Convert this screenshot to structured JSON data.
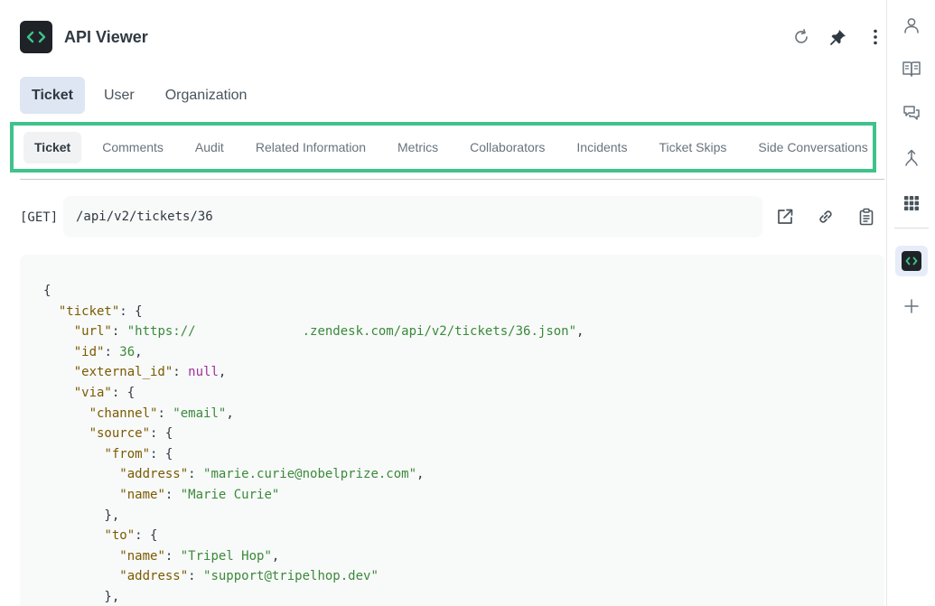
{
  "header": {
    "title": "API Viewer",
    "icons": [
      "refresh-icon",
      "pin-icon",
      "more-vertical-icon"
    ]
  },
  "primary_tabs": [
    {
      "label": "Ticket",
      "active": true
    },
    {
      "label": "User",
      "active": false
    },
    {
      "label": "Organization",
      "active": false
    }
  ],
  "sub_tabs": [
    {
      "label": "Ticket",
      "active": true
    },
    {
      "label": "Comments",
      "active": false
    },
    {
      "label": "Audit",
      "active": false
    },
    {
      "label": "Related Information",
      "active": false
    },
    {
      "label": "Metrics",
      "active": false
    },
    {
      "label": "Collaborators",
      "active": false
    },
    {
      "label": "Incidents",
      "active": false
    },
    {
      "label": "Ticket Skips",
      "active": false
    },
    {
      "label": "Side Conversations",
      "active": false
    }
  ],
  "request": {
    "method": "[GET]",
    "path": "/api/v2/tickets/36",
    "actions": [
      "open-external-icon",
      "link-icon",
      "copy-clipboard-icon"
    ]
  },
  "json_view": {
    "lines": [
      "{",
      "  \"ticket\": {",
      "    \"url\": \"https://              .zendesk.com/api/v2/tickets/36.json\",",
      "    \"id\": 36,",
      "    \"external_id\": null,",
      "    \"via\": {",
      "      \"channel\": \"email\",",
      "      \"source\": {",
      "        \"from\": {",
      "          \"address\": \"marie.curie@nobelprize.com\",",
      "          \"name\": \"Marie Curie\"",
      "        },",
      "        \"to\": {",
      "          \"name\": \"Tripel Hop\",",
      "          \"address\": \"support@tripelhop.dev\"",
      "        },"
    ]
  },
  "rail": {
    "icons": [
      "user-icon",
      "book-icon",
      "chat-icon",
      "merge-icon",
      "apps-grid-icon",
      "api-viewer-icon",
      "add-icon"
    ]
  },
  "colors": {
    "highlight": "#3fc38b",
    "active_tab_bg": "#dde6f2",
    "json_key": "#7a5b00",
    "json_string": "#3a8a3a",
    "json_null": "#a0319b"
  }
}
